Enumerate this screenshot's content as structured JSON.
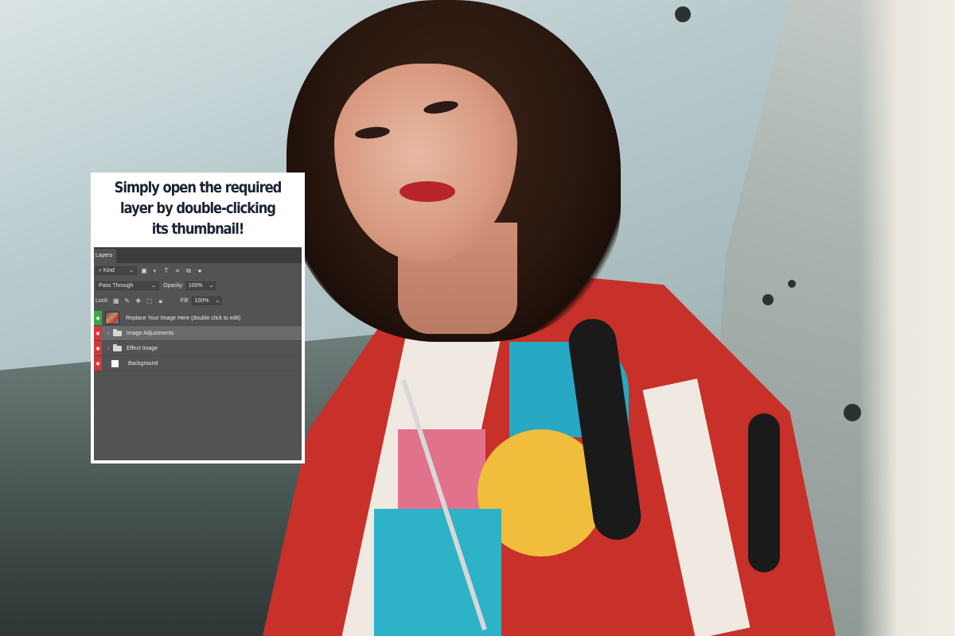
{
  "card": {
    "title_lines": [
      "Simply open the required",
      "layer by double-clicking",
      "its thumbnail!"
    ]
  },
  "layers_panel": {
    "tab_label": "Layers",
    "filter": {
      "value": "Kind",
      "icons": [
        "image-filter-icon",
        "adjustment-filter-icon",
        "type-filter-icon",
        "shape-filter-icon",
        "smart-object-filter-icon",
        "toggle-filter-icon"
      ]
    },
    "blend": {
      "mode": "Pass Through",
      "opacity_label": "Opacity:",
      "opacity_value": "100%"
    },
    "lock": {
      "label": "Lock:",
      "fill_label": "Fill:",
      "fill_value": "100%",
      "icons": [
        "lock-transparent-icon",
        "lock-paint-icon",
        "lock-position-icon",
        "lock-artboard-icon",
        "lock-all-icon"
      ]
    },
    "layers": [
      {
        "name": "Replace Your Image Here (double click to edit)",
        "kind": "smart-object",
        "eye_color": "#3aa84b",
        "selected": false
      },
      {
        "name": "Image Adjustments",
        "kind": "group",
        "eye_color": "#d13a3a",
        "selected": true
      },
      {
        "name": "Effect Image",
        "kind": "group",
        "eye_color": "#d13a3a",
        "selected": false
      },
      {
        "name": "Background",
        "kind": "background",
        "eye_color": "#d13a3a",
        "selected": false
      }
    ]
  },
  "colors": {
    "panel_bg": "#535353",
    "title_text": "#1b2233",
    "eye_red": "#d13a3a",
    "eye_green": "#3aa84b"
  }
}
